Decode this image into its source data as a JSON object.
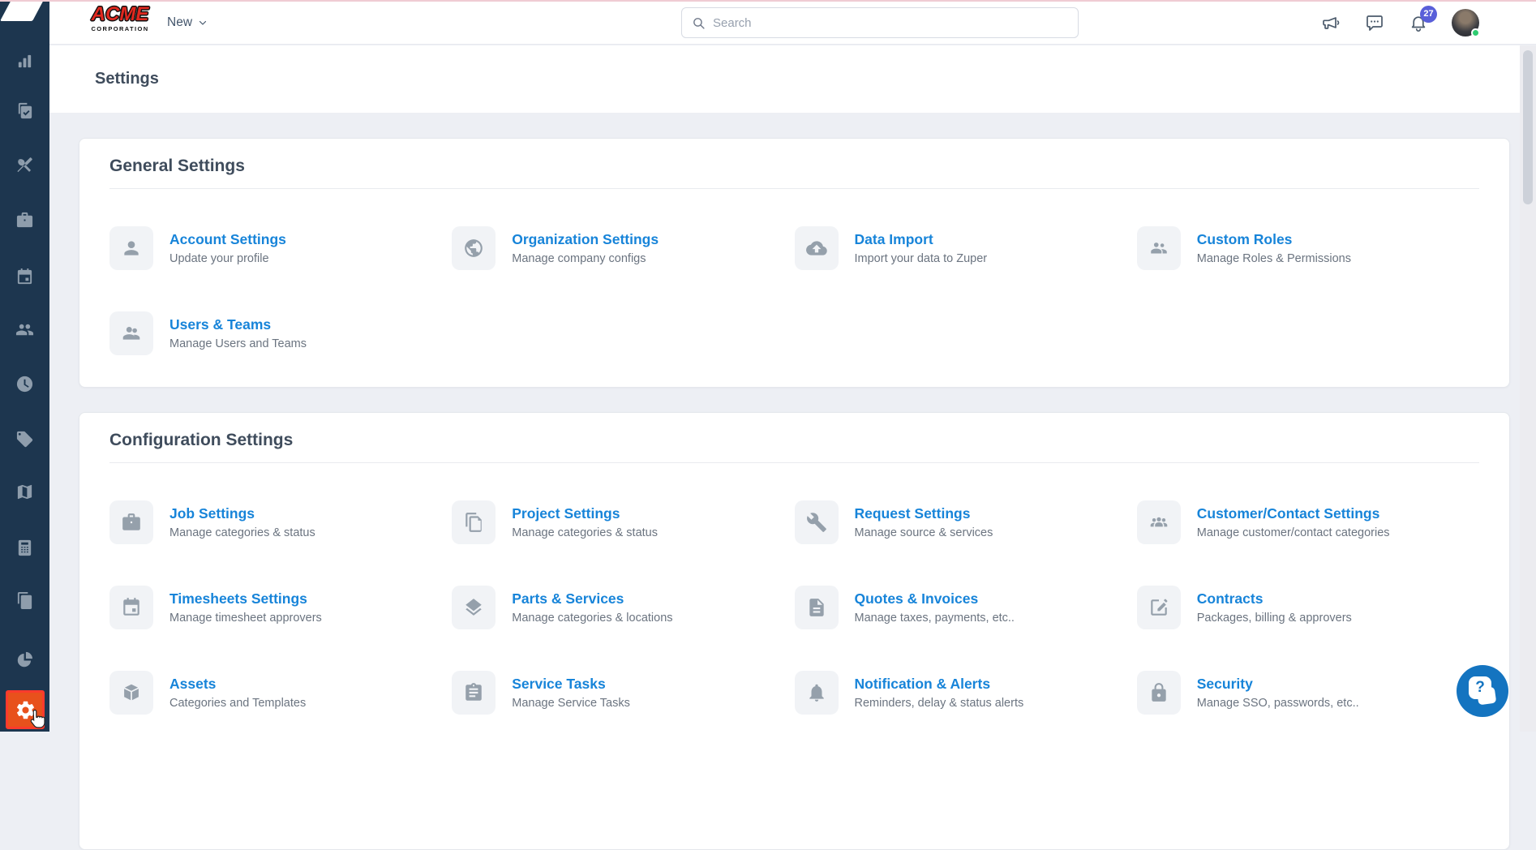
{
  "topbar": {
    "brand": {
      "line1": "ACME",
      "line2": "CORPORATION"
    },
    "new_menu_label": "New",
    "search": {
      "placeholder": "Search"
    },
    "notification_badge": "27"
  },
  "page": {
    "title": "Settings"
  },
  "sidebar": {
    "items": [
      {
        "icon": "analytics"
      },
      {
        "icon": "tasks"
      },
      {
        "icon": "tools"
      },
      {
        "icon": "briefcase"
      },
      {
        "icon": "calendar"
      },
      {
        "icon": "users"
      },
      {
        "icon": "clock"
      },
      {
        "icon": "tag"
      },
      {
        "icon": "map"
      },
      {
        "icon": "calculator"
      },
      {
        "icon": "documents"
      },
      {
        "icon": "pie-chart"
      }
    ],
    "active_item": {
      "icon": "gear"
    }
  },
  "sections": [
    {
      "title": "General Settings",
      "items": [
        {
          "icon": "person",
          "title": "Account Settings",
          "subtitle": "Update your profile"
        },
        {
          "icon": "globe",
          "title": "Organization Settings",
          "subtitle": "Manage company configs"
        },
        {
          "icon": "cloud-upload",
          "title": "Data Import",
          "subtitle": "Import your data to Zuper"
        },
        {
          "icon": "people-pair",
          "title": "Custom Roles",
          "subtitle": "Manage Roles & Permissions"
        },
        {
          "icon": "users-two",
          "title": "Users & Teams",
          "subtitle": "Manage Users and Teams"
        }
      ]
    },
    {
      "title": "Configuration Settings",
      "items": [
        {
          "icon": "briefcase",
          "title": "Job Settings",
          "subtitle": "Manage categories & status"
        },
        {
          "icon": "doc-copy",
          "title": "Project Settings",
          "subtitle": "Manage categories & status"
        },
        {
          "icon": "wrench",
          "title": "Request Settings",
          "subtitle": "Manage source & services"
        },
        {
          "icon": "people-three",
          "title": "Customer/Contact Settings",
          "subtitle": "Manage customer/contact categories"
        },
        {
          "icon": "calendar",
          "title": "Timesheets Settings",
          "subtitle": "Manage timesheet approvers"
        },
        {
          "icon": "layers",
          "title": "Parts & Services",
          "subtitle": "Manage categories & locations"
        },
        {
          "icon": "doc-lines",
          "title": "Quotes & Invoices",
          "subtitle": "Manage taxes, payments, etc.."
        },
        {
          "icon": "edit-square",
          "title": "Contracts",
          "subtitle": "Packages, billing & approvers"
        },
        {
          "icon": "cube",
          "title": "Assets",
          "subtitle": "Categories and Templates"
        },
        {
          "icon": "clipboard",
          "title": "Service Tasks",
          "subtitle": "Manage Service Tasks"
        },
        {
          "icon": "bell",
          "title": "Notification & Alerts",
          "subtitle": "Reminders, delay & status alerts"
        },
        {
          "icon": "lock",
          "title": "Security",
          "subtitle": "Manage SSO, passwords, etc.."
        }
      ]
    }
  ],
  "help_fab": {
    "glyph": "?"
  },
  "colors": {
    "sidebar_bg": "#1d364f",
    "accent_blue": "#1784d9",
    "badge_indigo": "#595fd9",
    "active_orange": "#e8511c",
    "active_border_red": "#fb3b2d",
    "help_blue": "#1474c0",
    "page_bg": "#edeff4"
  }
}
